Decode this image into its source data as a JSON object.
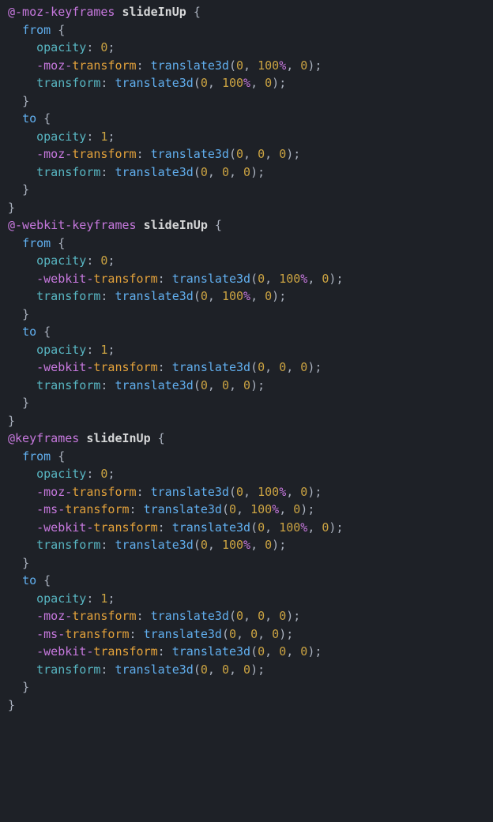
{
  "code": {
    "blocks": [
      {
        "at_rule": "@-moz-keyframes",
        "anim_name": "slideInUp",
        "sections": [
          {
            "label": "from",
            "decls": [
              {
                "prop": "opacity",
                "vendor": false,
                "value_kind": "num",
                "value": "0"
              },
              {
                "prop": "-moz-transform",
                "vendor": true,
                "value_kind": "translate",
                "args": [
                  "0",
                  "100%",
                  "0"
                ]
              },
              {
                "prop": "transform",
                "vendor": false,
                "value_kind": "translate",
                "args": [
                  "0",
                  "100%",
                  "0"
                ]
              }
            ]
          },
          {
            "label": "to",
            "decls": [
              {
                "prop": "opacity",
                "vendor": false,
                "value_kind": "num",
                "value": "1"
              },
              {
                "prop": "-moz-transform",
                "vendor": true,
                "value_kind": "translate",
                "args": [
                  "0",
                  "0",
                  "0"
                ]
              },
              {
                "prop": "transform",
                "vendor": false,
                "value_kind": "translate",
                "args": [
                  "0",
                  "0",
                  "0"
                ]
              }
            ]
          }
        ]
      },
      {
        "at_rule": "@-webkit-keyframes",
        "anim_name": "slideInUp",
        "sections": [
          {
            "label": "from",
            "decls": [
              {
                "prop": "opacity",
                "vendor": false,
                "value_kind": "num",
                "value": "0"
              },
              {
                "prop": "-webkit-transform",
                "vendor": true,
                "value_kind": "translate",
                "args": [
                  "0",
                  "100%",
                  "0"
                ]
              },
              {
                "prop": "transform",
                "vendor": false,
                "value_kind": "translate",
                "args": [
                  "0",
                  "100%",
                  "0"
                ]
              }
            ]
          },
          {
            "label": "to",
            "decls": [
              {
                "prop": "opacity",
                "vendor": false,
                "value_kind": "num",
                "value": "1"
              },
              {
                "prop": "-webkit-transform",
                "vendor": true,
                "value_kind": "translate",
                "args": [
                  "0",
                  "0",
                  "0"
                ]
              },
              {
                "prop": "transform",
                "vendor": false,
                "value_kind": "translate",
                "args": [
                  "0",
                  "0",
                  "0"
                ]
              }
            ]
          }
        ]
      },
      {
        "at_rule": "@keyframes",
        "anim_name": "slideInUp",
        "sections": [
          {
            "label": "from",
            "decls": [
              {
                "prop": "opacity",
                "vendor": false,
                "value_kind": "num",
                "value": "0"
              },
              {
                "prop": "-moz-transform",
                "vendor": true,
                "value_kind": "translate",
                "args": [
                  "0",
                  "100%",
                  "0"
                ]
              },
              {
                "prop": "-ms-transform",
                "vendor": true,
                "value_kind": "translate",
                "args": [
                  "0",
                  "100%",
                  "0"
                ]
              },
              {
                "prop": "-webkit-transform",
                "vendor": true,
                "value_kind": "translate",
                "args": [
                  "0",
                  "100%",
                  "0"
                ]
              },
              {
                "prop": "transform",
                "vendor": false,
                "value_kind": "translate",
                "args": [
                  "0",
                  "100%",
                  "0"
                ]
              }
            ]
          },
          {
            "label": "to",
            "decls": [
              {
                "prop": "opacity",
                "vendor": false,
                "value_kind": "num",
                "value": "1"
              },
              {
                "prop": "-moz-transform",
                "vendor": true,
                "value_kind": "translate",
                "args": [
                  "0",
                  "0",
                  "0"
                ]
              },
              {
                "prop": "-ms-transform",
                "vendor": true,
                "value_kind": "translate",
                "args": [
                  "0",
                  "0",
                  "0"
                ]
              },
              {
                "prop": "-webkit-transform",
                "vendor": true,
                "value_kind": "translate",
                "args": [
                  "0",
                  "0",
                  "0"
                ]
              },
              {
                "prop": "transform",
                "vendor": false,
                "value_kind": "translate",
                "args": [
                  "0",
                  "0",
                  "0"
                ]
              }
            ]
          }
        ]
      }
    ],
    "func_name": "translate3d",
    "indent": "  "
  }
}
